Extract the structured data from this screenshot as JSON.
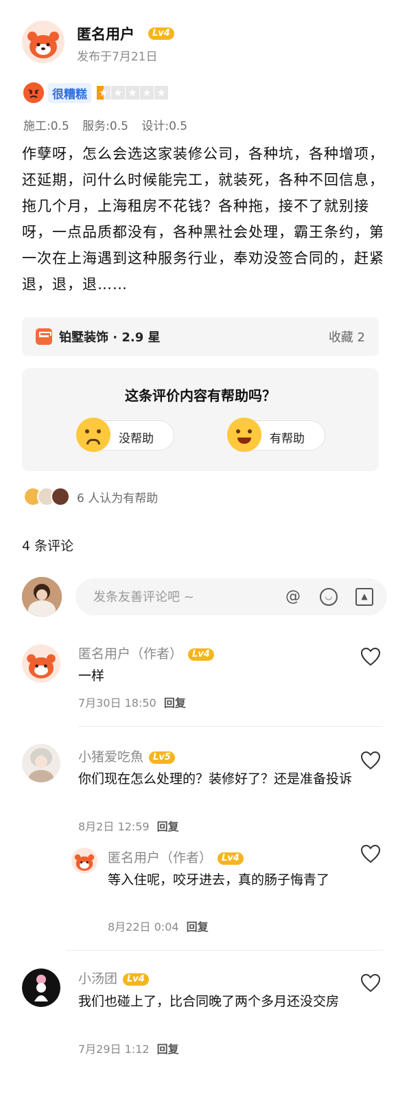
{
  "post": {
    "author_name": "匿名用户",
    "author_level": "Lv4",
    "date": "发布于7月21日",
    "rating_label": "很糟糕",
    "rating_stars": 0.5,
    "scores": [
      "施工:0.5",
      "服务:0.5",
      "设计:0.5"
    ],
    "body": "作孽呀，怎么会选这家装修公司，各种坑，各种增项，还延期，问什么时候能完工，就装死，各种不回信息，拖几个月，上海租房不花钱？各种拖，接不了就别接呀，一点品质都没有，各种黑社会处理，霸王条约，第一次在上海遇到这种服务行业，奉劝没签合同的，赶紧退，退，退……"
  },
  "shop": {
    "name": "铂墅装饰 · 2.9 星",
    "favorites": "收藏 2"
  },
  "helpful": {
    "question": "这条评价内容有帮助吗？",
    "no_label": "没帮助",
    "yes_label": "有帮助",
    "count_text": "6 人认为有帮助"
  },
  "comments_header": "4 条评论",
  "comment_input": {
    "placeholder": "发条友善评论吧 ~"
  },
  "colors": {
    "level_badge": "#f5b51d",
    "rating_label": "#2f6fe0"
  },
  "comments": [
    {
      "name": "匿名用户（作者）",
      "level": "Lv4",
      "text": "一样",
      "time": "7月30日  18:50",
      "reply_label": "回复"
    },
    {
      "name": "小猪爱吃魚",
      "level": "Lv5",
      "text": "你们现在怎么处理的？装修好了？还是准备投诉",
      "time": "8月2日  12:59",
      "reply_label": "回复"
    },
    {
      "name": "匿名用户（作者）",
      "level": "Lv4",
      "text": "等入住呢，咬牙进去，真的肠子悔青了",
      "time": "8月22日  0:04",
      "reply_label": "回复"
    },
    {
      "name": "小汤团",
      "level": "Lv4",
      "text": "我们也碰上了，比合同晚了两个多月还没交房",
      "time": "7月29日  1:12",
      "reply_label": "回复"
    }
  ]
}
